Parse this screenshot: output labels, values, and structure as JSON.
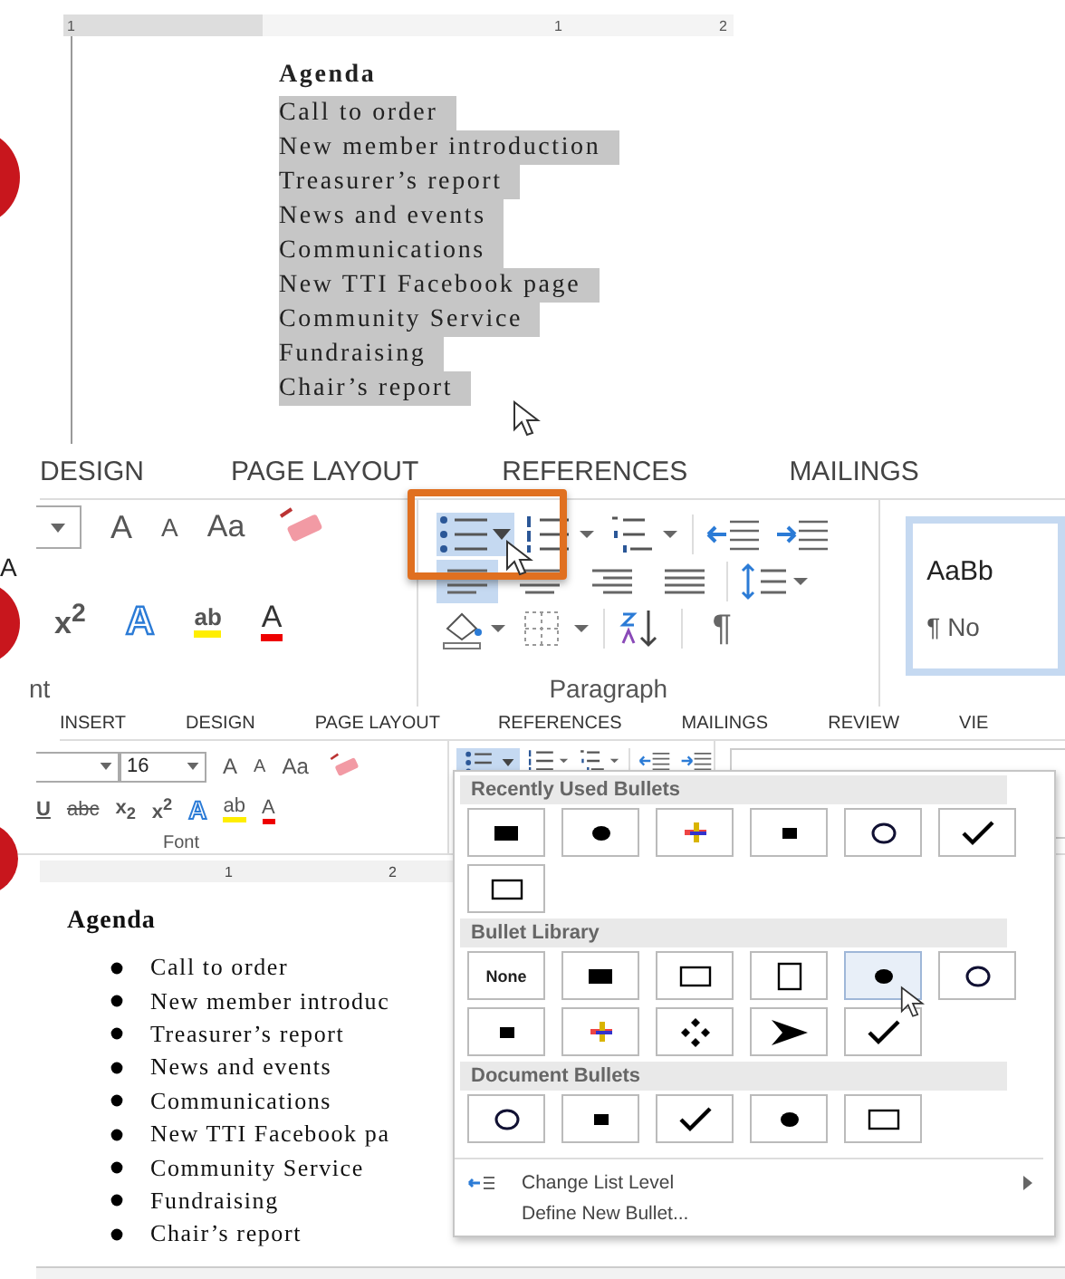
{
  "step1": {
    "ruler_labels": [
      "1",
      "1",
      "2"
    ],
    "heading": "Agenda",
    "items": [
      {
        "text": "Call to order",
        "selected": true
      },
      {
        "text": "New member introduction",
        "selected": true
      },
      {
        "text": "Treasurer’s report",
        "selected": true
      },
      {
        "text": "News and events",
        "selected": true
      },
      {
        "text": "Communications",
        "selected": true
      },
      {
        "text": "New TTI Facebook page",
        "selected": true
      },
      {
        "text": "Community Service",
        "selected": true
      },
      {
        "text": "Fundraising",
        "selected": true
      },
      {
        "text": "Chair’s report",
        "selected": true
      }
    ]
  },
  "step2": {
    "tabs": [
      "DESIGN",
      "PAGE LAYOUT",
      "REFERENCES",
      "MAILINGS"
    ],
    "cut_text": "A",
    "font_tools": [
      {
        "kind": "grow",
        "text": "A"
      },
      {
        "kind": "shrink",
        "text": "A"
      },
      {
        "kind": "case",
        "text": "Aa"
      }
    ],
    "format_tools": [
      {
        "kind": "superscript",
        "text": "x$^{2}$"
      },
      {
        "kind": "effects",
        "text": "A"
      },
      {
        "kind": "highlight",
        "text": "ab"
      },
      {
        "kind": "color",
        "text": "A"
      }
    ],
    "bullets_pressed": true,
    "align_left_pressed": true,
    "pilcrow": "¶",
    "group_labels": [
      "nt",
      "Paragraph"
    ],
    "style": {
      "sample": "AaBb",
      "name": "¶ No"
    }
  },
  "step3": {
    "tabs": [
      "INSERT",
      "DESIGN",
      "PAGE LAYOUT",
      "REFERENCES",
      "MAILINGS",
      "REVIEW",
      "VIE"
    ],
    "font_size": "16",
    "font_tools": [
      {
        "kind": "grow",
        "text": "A"
      },
      {
        "kind": "shrink",
        "text": "A"
      },
      {
        "kind": "case",
        "text": "Aa"
      }
    ],
    "format_tools": [
      {
        "kind": "underline",
        "text": "U"
      },
      {
        "kind": "strike",
        "text": "abc"
      },
      {
        "kind": "subscript",
        "text": "x$_{2}$"
      },
      {
        "kind": "superscript",
        "text": "x$^{2}$"
      },
      {
        "kind": "effects",
        "text": "A"
      },
      {
        "kind": "highlight",
        "text": "ab"
      },
      {
        "kind": "color",
        "text": "A"
      }
    ],
    "bullets_pressed": true,
    "group_label": "Font",
    "ruler_labels": [
      "1",
      "2"
    ],
    "heading": "Agenda",
    "items": [
      "Call to order",
      "New member introduc",
      "Treasurer’s report",
      "News and events",
      "Communications",
      "New TTI Facebook pa",
      "Community Service",
      "Fundraising",
      "Chair’s report"
    ],
    "menu": {
      "sections": [
        {
          "title": "Recently Used Bullets",
          "bullets": [
            {
              "kind": "square",
              "selected": false
            },
            {
              "kind": "dot",
              "selected": false
            },
            {
              "kind": "cross",
              "selected": false
            },
            {
              "kind": "small-square",
              "selected": false
            },
            {
              "kind": "circle",
              "selected": false
            },
            {
              "kind": "check",
              "selected": false
            },
            {
              "kind": "rect",
              "selected": false
            }
          ]
        },
        {
          "title": "Bullet Library",
          "bullets": [
            {
              "kind": "none",
              "text": "None",
              "selected": false
            },
            {
              "kind": "square",
              "selected": false
            },
            {
              "kind": "rect",
              "selected": false
            },
            {
              "kind": "hollow-square",
              "selected": false
            },
            {
              "kind": "dot",
              "selected": true
            },
            {
              "kind": "circle",
              "selected": false
            },
            {
              "kind": "small-square",
              "selected": false
            },
            {
              "kind": "cross",
              "selected": false
            },
            {
              "kind": "diamonds",
              "selected": false
            },
            {
              "kind": "arrow",
              "selected": false
            },
            {
              "kind": "check",
              "selected": false
            }
          ]
        },
        {
          "title": "Document Bullets",
          "bullets": [
            {
              "kind": "circle",
              "selected": false
            },
            {
              "kind": "small-square",
              "selected": false
            },
            {
              "kind": "check",
              "selected": false
            },
            {
              "kind": "dot",
              "selected": false
            },
            {
              "kind": "rect",
              "selected": false
            }
          ]
        }
      ],
      "commands": [
        {
          "kind": "level",
          "text": "Change List Level",
          "submenu": true
        },
        {
          "kind": "define",
          "text": "Define New Bullet...",
          "submenu": false
        }
      ]
    }
  }
}
